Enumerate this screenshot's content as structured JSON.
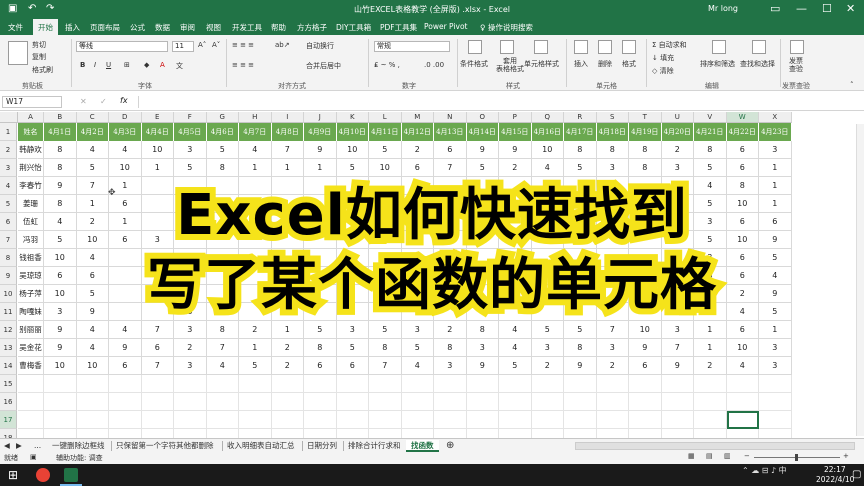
{
  "window": {
    "title": "山竹EXCEL表格教学 (全屏版) .xlsx  -  Excel",
    "user": "Mr long"
  },
  "tabs": [
    "文件",
    "开始",
    "插入",
    "页面布局",
    "公式",
    "数据",
    "审阅",
    "视图",
    "开发工具",
    "帮助",
    "方方格子",
    "DIY工具箱",
    "PDF工具集",
    "Power Pivot",
    "操作说明搜索"
  ],
  "active_tab": "开始",
  "ribbon": {
    "clipboard": {
      "cut": "剪切",
      "copy": "复制",
      "format_painter": "格式刷",
      "group": "剪贴板"
    },
    "font": {
      "name": "等线",
      "size": "11",
      "group": "字体"
    },
    "alignment": {
      "wrap": "自动换行",
      "merge": "合并后居中",
      "group": "对齐方式"
    },
    "number": {
      "format": "常规",
      "group": "数字"
    },
    "styles": {
      "cond": "条件格式",
      "table": "套用\n表格格式",
      "cell": "单元格样式",
      "group": "样式"
    },
    "cells": {
      "insert": "插入",
      "delete": "删除",
      "format": "格式",
      "group": "单元格"
    },
    "editing": {
      "autosum": "自动求和",
      "fill": "填充",
      "clear": "清除",
      "sort": "排序和筛选",
      "find": "查找和选择",
      "group": "编辑"
    },
    "send": {
      "label": "发票\n查验",
      "group": "发票查验"
    }
  },
  "formula_bar": {
    "name_box": "W17",
    "fx": "fx"
  },
  "columns": [
    "A",
    "B",
    "C",
    "D",
    "E",
    "F",
    "G",
    "H",
    "I",
    "J",
    "K",
    "L",
    "M",
    "N",
    "O",
    "P",
    "Q",
    "R",
    "S",
    "T",
    "U",
    "V",
    "W",
    "X"
  ],
  "header_row": [
    "姓名",
    "4月1日",
    "4月2日",
    "4月3日",
    "4月4日",
    "4月5日",
    "4月6日",
    "4月7日",
    "4月8日",
    "4月9日",
    "4月10日",
    "4月11日",
    "4月12日",
    "4月13日",
    "4月14日",
    "4月15日",
    "4月16日",
    "4月17日",
    "4月18日",
    "4月19日",
    "4月20日",
    "4月21日",
    "4月22日",
    "4月23日"
  ],
  "rows": [
    [
      "韩静欢",
      "8",
      "4",
      "4",
      "10",
      "3",
      "5",
      "4",
      "7",
      "9",
      "10",
      "5",
      "2",
      "6",
      "9",
      "9",
      "10",
      "8",
      "8",
      "8",
      "2",
      "8",
      "6",
      "3"
    ],
    [
      "荆兴怡",
      "8",
      "5",
      "10",
      "1",
      "5",
      "8",
      "1",
      "1",
      "1",
      "5",
      "10",
      "6",
      "7",
      "5",
      "2",
      "4",
      "5",
      "3",
      "8",
      "3",
      "5",
      "6",
      "1"
    ],
    [
      "李春竹",
      "9",
      "7",
      "1",
      "",
      "",
      "",
      "",
      "",
      "",
      "",
      "",
      "",
      "",
      "",
      "",
      "",
      "",
      "",
      "",
      "3",
      "4",
      "8",
      "1"
    ],
    [
      "姜珊",
      "8",
      "1",
      "6",
      "",
      "",
      "",
      "",
      "",
      "",
      "",
      "",
      "",
      "",
      "",
      "",
      "",
      "",
      "",
      "",
      "5",
      "5",
      "10",
      "1"
    ],
    [
      "伍虹",
      "4",
      "2",
      "1",
      "",
      "",
      "",
      "",
      "",
      "",
      "",
      "",
      "",
      "",
      "",
      "",
      "",
      "",
      "",
      "",
      "8",
      "3",
      "6",
      "6"
    ],
    [
      "冯羽",
      "5",
      "10",
      "6",
      "3",
      "",
      "",
      "",
      "",
      "",
      "",
      "",
      "",
      "",
      "",
      "",
      "",
      "",
      "",
      "",
      "",
      "5",
      "10",
      "9"
    ],
    [
      "钱祖香",
      "10",
      "4",
      "",
      "",
      "",
      "",
      "",
      "",
      "",
      "",
      "",
      "",
      "",
      "",
      "",
      "",
      "",
      "",
      "",
      "",
      "3",
      "6",
      "5"
    ],
    [
      "吴琼琼",
      "6",
      "6",
      "",
      "",
      "",
      "",
      "",
      "",
      "",
      "",
      "",
      "",
      "",
      "",
      "",
      "",
      "",
      "",
      "",
      "",
      "6",
      "6",
      "4"
    ],
    [
      "杨子萍",
      "10",
      "5",
      "",
      "",
      "7",
      "",
      "",
      "",
      "",
      "",
      "",
      "",
      "",
      "",
      "",
      "",
      "",
      "",
      "",
      "",
      "",
      "2",
      "9"
    ],
    [
      "陶嘎妹",
      "3",
      "9",
      "",
      "",
      "8",
      "",
      "",
      "",
      "",
      "",
      "",
      "",
      "",
      "",
      "",
      "",
      "",
      "",
      "",
      "",
      "",
      "4",
      "5"
    ],
    [
      "别丽丽",
      "9",
      "4",
      "4",
      "7",
      "3",
      "8",
      "2",
      "1",
      "5",
      "3",
      "5",
      "3",
      "2",
      "8",
      "4",
      "5",
      "5",
      "7",
      "10",
      "3",
      "1",
      "6",
      "1"
    ],
    [
      "吴金花",
      "9",
      "4",
      "9",
      "6",
      "2",
      "7",
      "1",
      "2",
      "8",
      "5",
      "8",
      "5",
      "8",
      "3",
      "4",
      "3",
      "8",
      "3",
      "9",
      "7",
      "1",
      "10",
      "3"
    ],
    [
      "曹梅香",
      "10",
      "10",
      "6",
      "7",
      "3",
      "4",
      "5",
      "2",
      "6",
      "6",
      "7",
      "4",
      "3",
      "9",
      "5",
      "2",
      "9",
      "2",
      "6",
      "9",
      "2",
      "4",
      "3"
    ]
  ],
  "row_numbers": [
    "1",
    "2",
    "3",
    "4",
    "5",
    "6",
    "7",
    "8",
    "9",
    "10",
    "11",
    "12",
    "13",
    "14",
    "15",
    "16",
    "17",
    "18"
  ],
  "overlay": {
    "line1": "Excel如何快速找到",
    "line2": "写了某个函数的单元格"
  },
  "sheet_tabs": [
    "...",
    "一键删除边框线",
    "只保留第一个字符其他都删除",
    "收入明细表自动汇总",
    "日期分列",
    "排除合计行求和",
    "找函数"
  ],
  "active_sheet": "找函数",
  "status": {
    "mode": "就绪",
    "accessibility": "辅助功能: 调查"
  },
  "taskbar": {
    "time": "22:17",
    "date": "2022/4/10"
  },
  "colors": {
    "excel_green": "#217346",
    "header_green": "#6aa84f",
    "overlay_yellow": "#f5e31a"
  }
}
